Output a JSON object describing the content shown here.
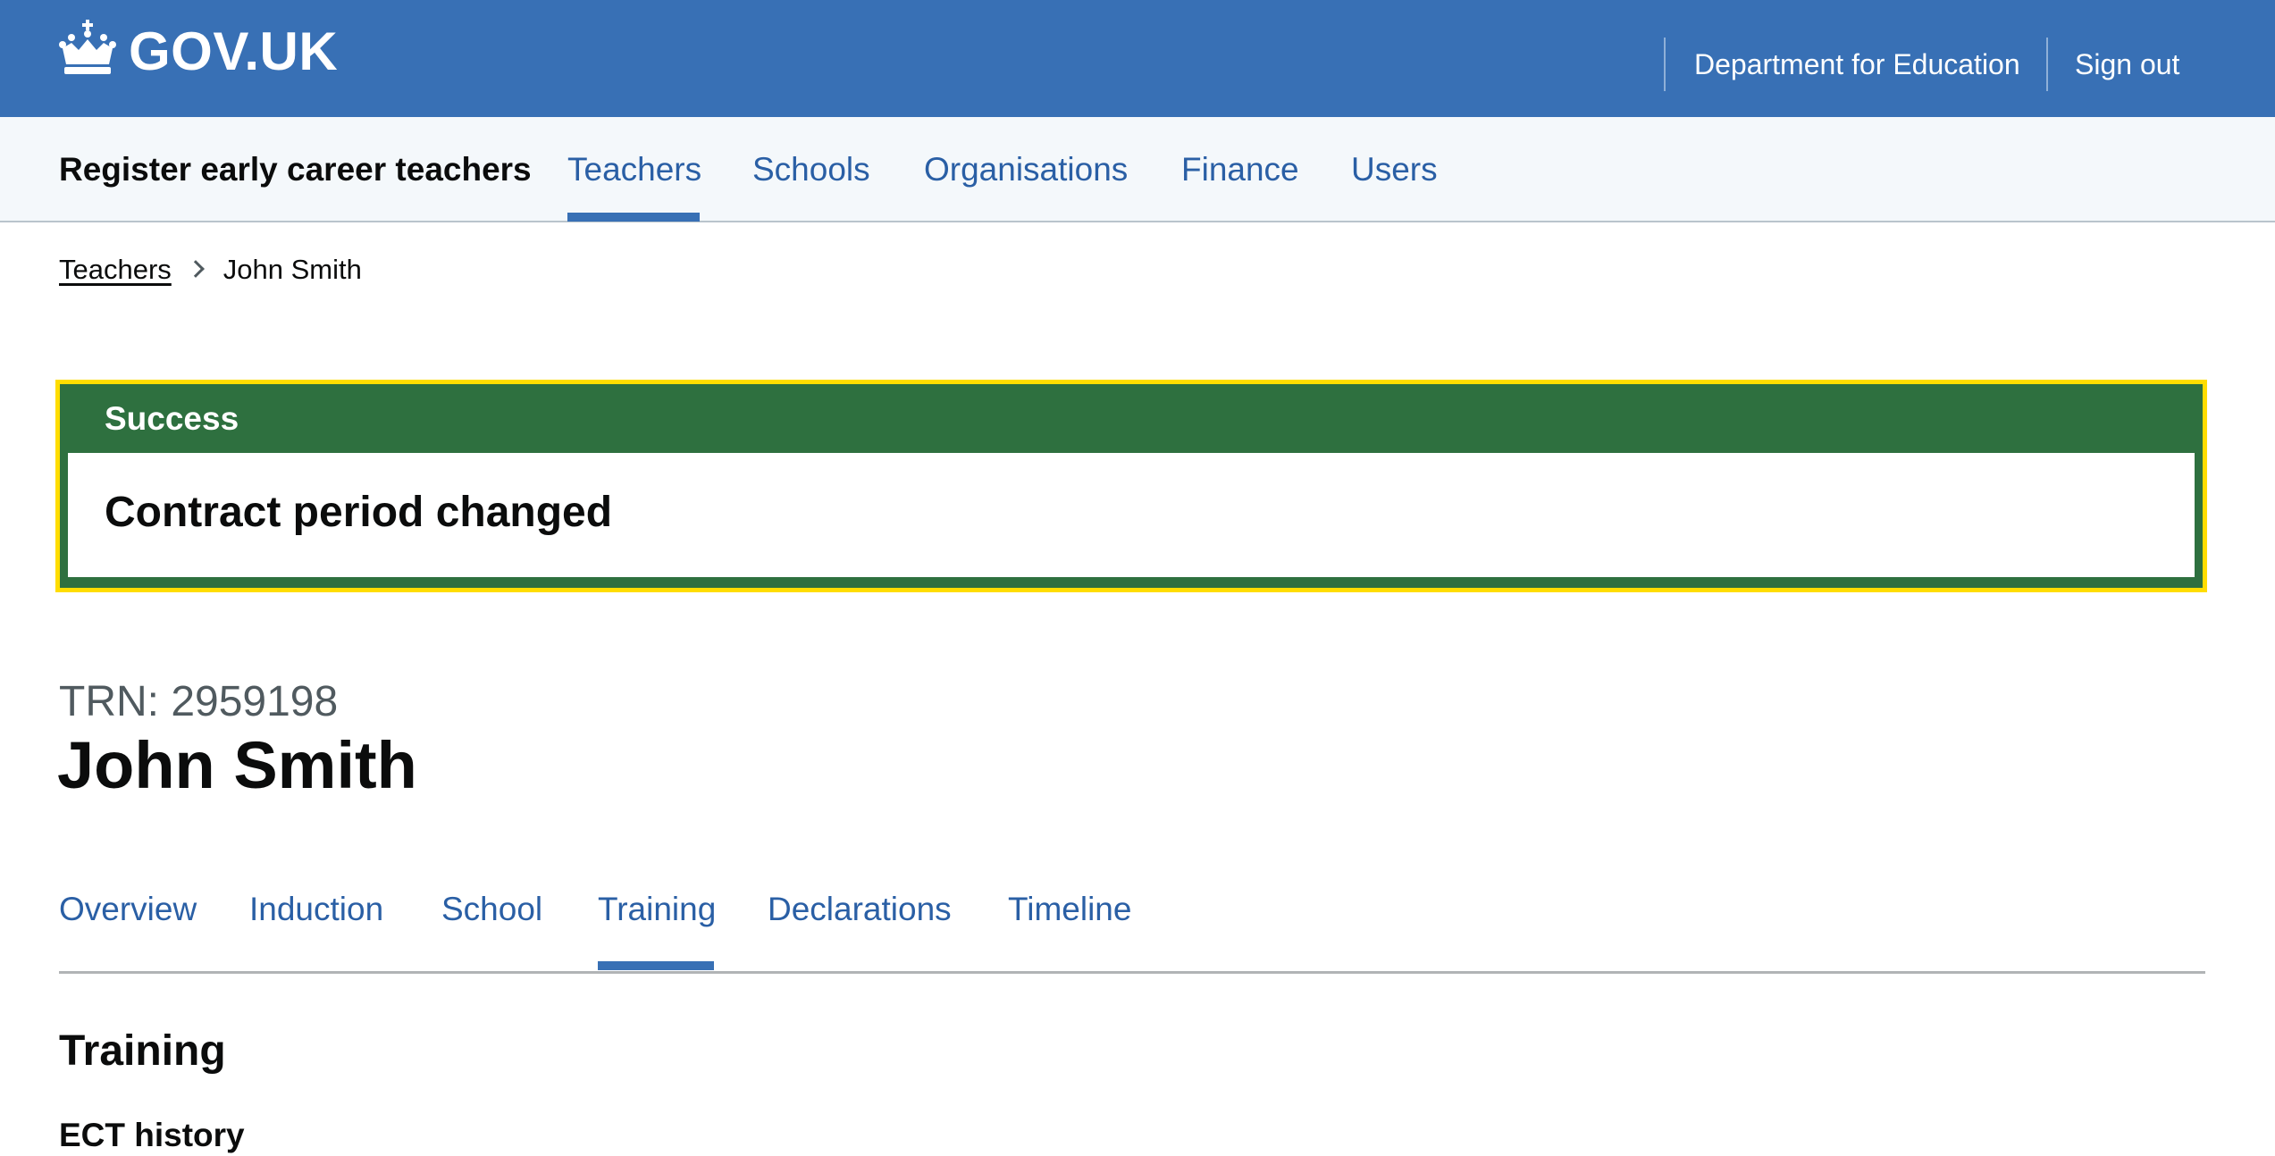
{
  "header": {
    "logo_text": "GOV.UK",
    "logo_icon": "crown-icon",
    "department_link": "Department for Education",
    "sign_out_link": "Sign out"
  },
  "service_nav": {
    "service_name": "Register early career teachers",
    "active": "Teachers",
    "items": [
      {
        "label": "Teachers"
      },
      {
        "label": "Schools"
      },
      {
        "label": "Organisations"
      },
      {
        "label": "Finance"
      },
      {
        "label": "Users"
      }
    ]
  },
  "breadcrumb": {
    "items": [
      {
        "label": "Teachers"
      },
      {
        "label": "John Smith"
      }
    ]
  },
  "banner": {
    "title": "Success",
    "heading": "Contract period changed"
  },
  "teacher": {
    "caption": "TRN: 2959198",
    "name": "John Smith"
  },
  "sub_nav": {
    "active": "Training",
    "items": [
      {
        "label": "Overview"
      },
      {
        "label": "Induction"
      },
      {
        "label": "School"
      },
      {
        "label": "Training"
      },
      {
        "label": "Declarations"
      },
      {
        "label": "Timeline"
      }
    ]
  },
  "content": {
    "section_heading": "Training",
    "subsection_heading": "ECT history"
  },
  "colors": {
    "header_blue": "#3870b5",
    "link_blue": "#2a5fa5",
    "success_green": "#2e703f",
    "focus_yellow": "#ffdd00"
  }
}
